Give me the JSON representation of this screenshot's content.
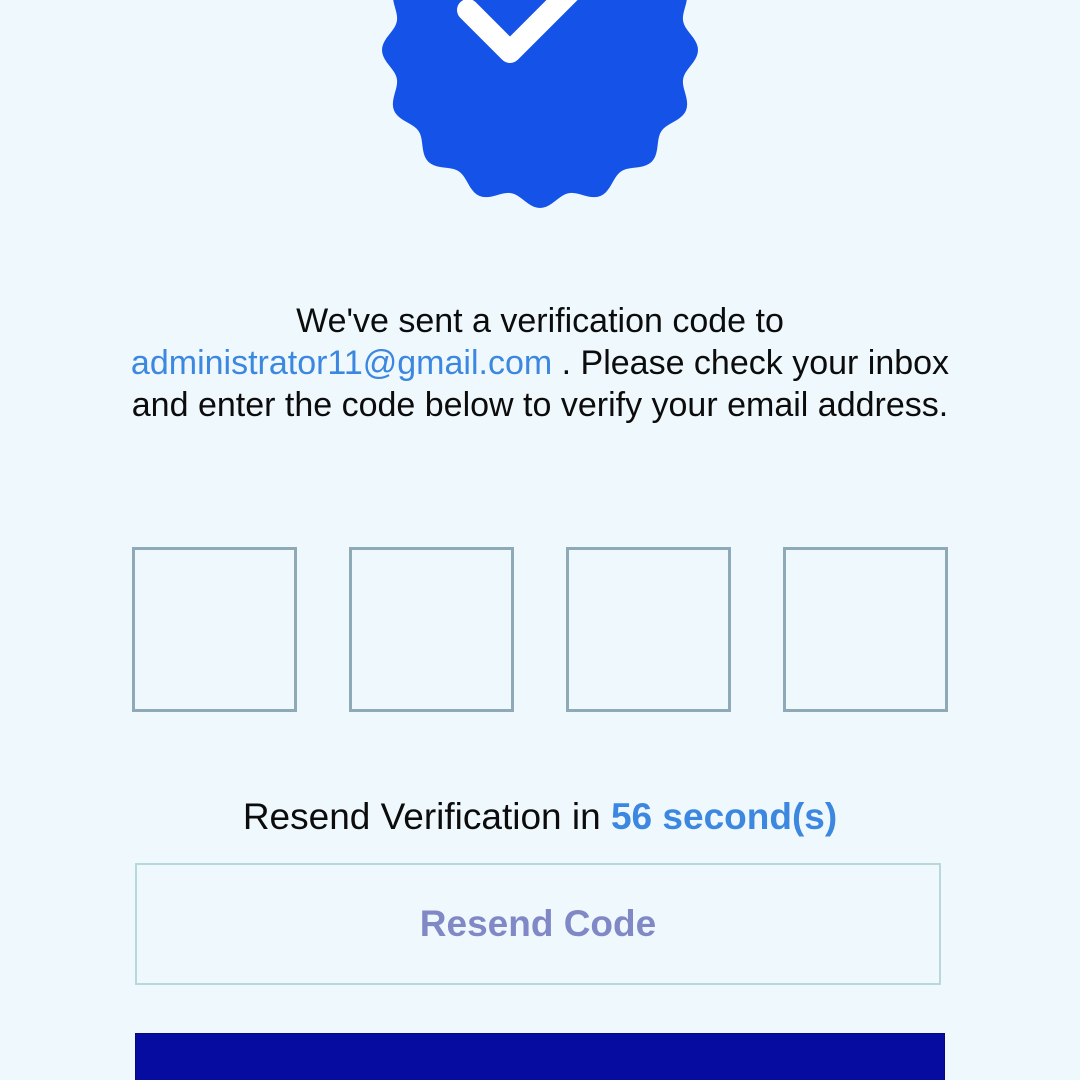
{
  "message": {
    "line_prefix": "We've sent a verification code to",
    "email": "administrator11@gmail.com",
    "line_suffix": ". Please check your inbox and enter the code below to verify your email address."
  },
  "code_inputs": [
    {
      "value": ""
    },
    {
      "value": ""
    },
    {
      "value": ""
    },
    {
      "value": ""
    }
  ],
  "resend": {
    "timer_prefix": "Resend Verification in",
    "countdown": "56 second(s)",
    "button_label": "Resend Code"
  },
  "icons": {
    "badge": "verified-badge-icon"
  },
  "colors": {
    "background": "#eff9fd",
    "accent": "#3c87e0",
    "badge": "#1552e8",
    "primary_button": "#060ca0",
    "resend_text": "#8088c6",
    "box_border": "#8daab6"
  }
}
